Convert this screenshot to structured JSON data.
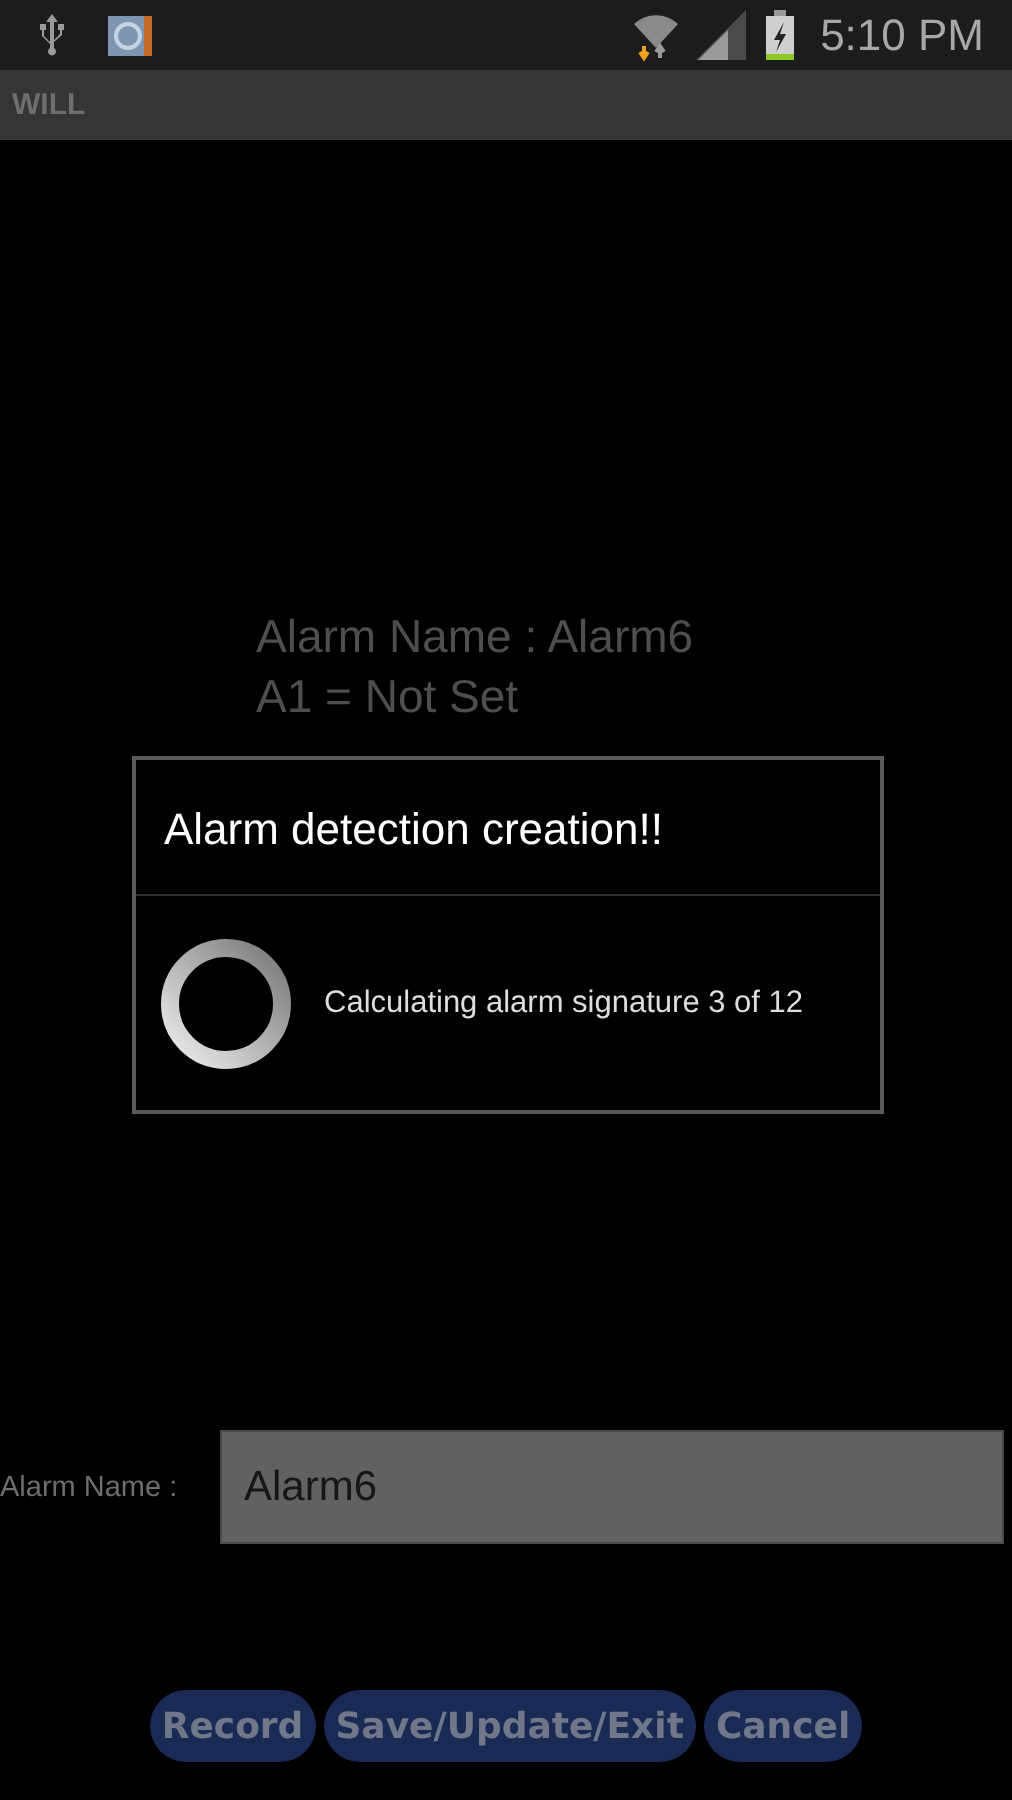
{
  "status_bar": {
    "time": "5:10 PM"
  },
  "app_bar": {
    "title": "WILL"
  },
  "info_lines": [
    "Alarm Name : Alarm6",
    "A1 = Not Set"
  ],
  "dialog": {
    "title": "Alarm detection creation!!",
    "message": "Calculating alarm signature 3 of 12"
  },
  "name_field": {
    "label": "Alarm Name :",
    "value": "Alarm6"
  },
  "buttons": [
    "Record",
    "Save/Update/Exit",
    "Cancel"
  ]
}
